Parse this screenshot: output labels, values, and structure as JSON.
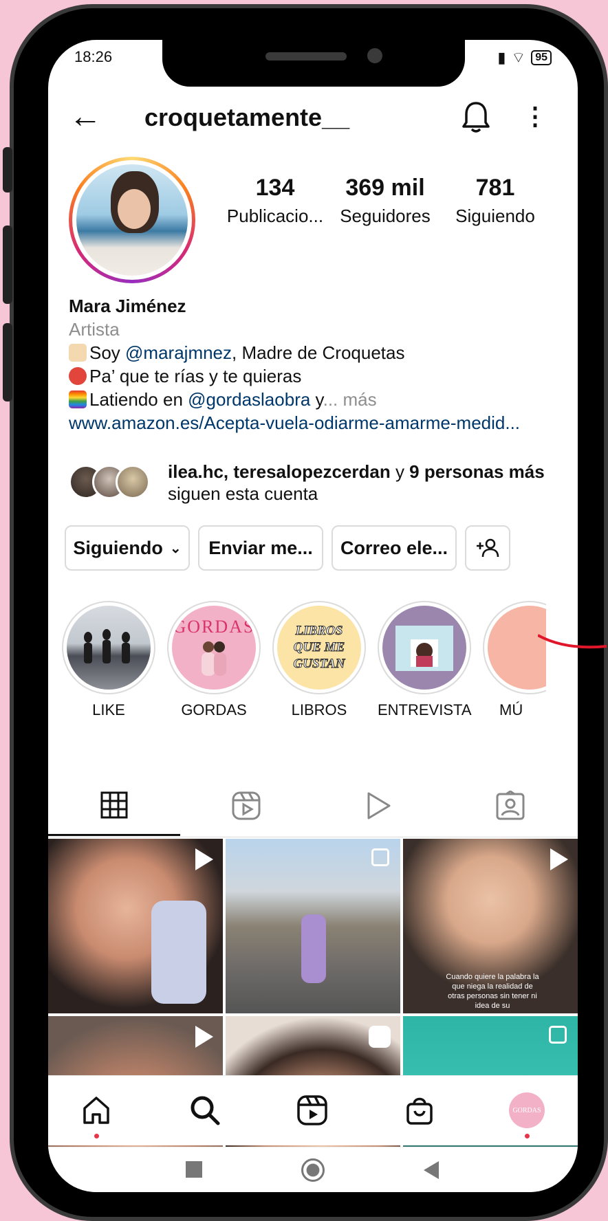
{
  "status_bar": {
    "time": "18:26",
    "battery": "95"
  },
  "header": {
    "username": "croquetamente__"
  },
  "profile": {
    "stats": [
      {
        "value": "134",
        "label": "Publicacio..."
      },
      {
        "value": "369 mil",
        "label": "Seguidores"
      },
      {
        "value": "781",
        "label": "Siguiendo"
      }
    ],
    "name": "Mara Jiménez",
    "category": "Artista",
    "bio": {
      "line1_pre": "Soy ",
      "line1_mention": "@marajmnez",
      "line1_post": ", Madre de Croquetas",
      "line2": "Pa’ que te rías y te quieras",
      "line3_pre": "Latiendo en ",
      "line3_mention": "@gordaslaobra",
      "line3_post": " y",
      "line3_more": "... más",
      "website": "www.amazon.es/Acepta-vuela-odiarme-amarme-medid..."
    },
    "followed_by": {
      "names": "ilea.hc, teresalopezcerdan",
      "connector": " y ",
      "others": "9 personas más",
      "suffix": "siguen esta cuenta"
    }
  },
  "actions": {
    "following": "Siguiendo",
    "message": "Enviar me...",
    "email": "Correo ele..."
  },
  "highlights": [
    {
      "label": "LIKE"
    },
    {
      "label": "GORDAS",
      "cover_text": "GORDAS"
    },
    {
      "label": "LIBROS",
      "cover_text": "LIBROS QUE ME GUSTAN"
    },
    {
      "label": "ENTREVISTA"
    },
    {
      "label": "MÚ"
    }
  ],
  "tabs": [
    "grid-icon",
    "reels-icon",
    "video-icon",
    "tagged-icon"
  ],
  "post_caption": "Cuando quiere la palabra la que niega la realidad de otras personas sin tener ni idea de su",
  "nav_avatar_text": "GORDAS",
  "colors": {
    "link": "#00376b",
    "muted": "#8e8e8e",
    "notification_dot": "#e6374a",
    "background": "#f7c6d6"
  }
}
